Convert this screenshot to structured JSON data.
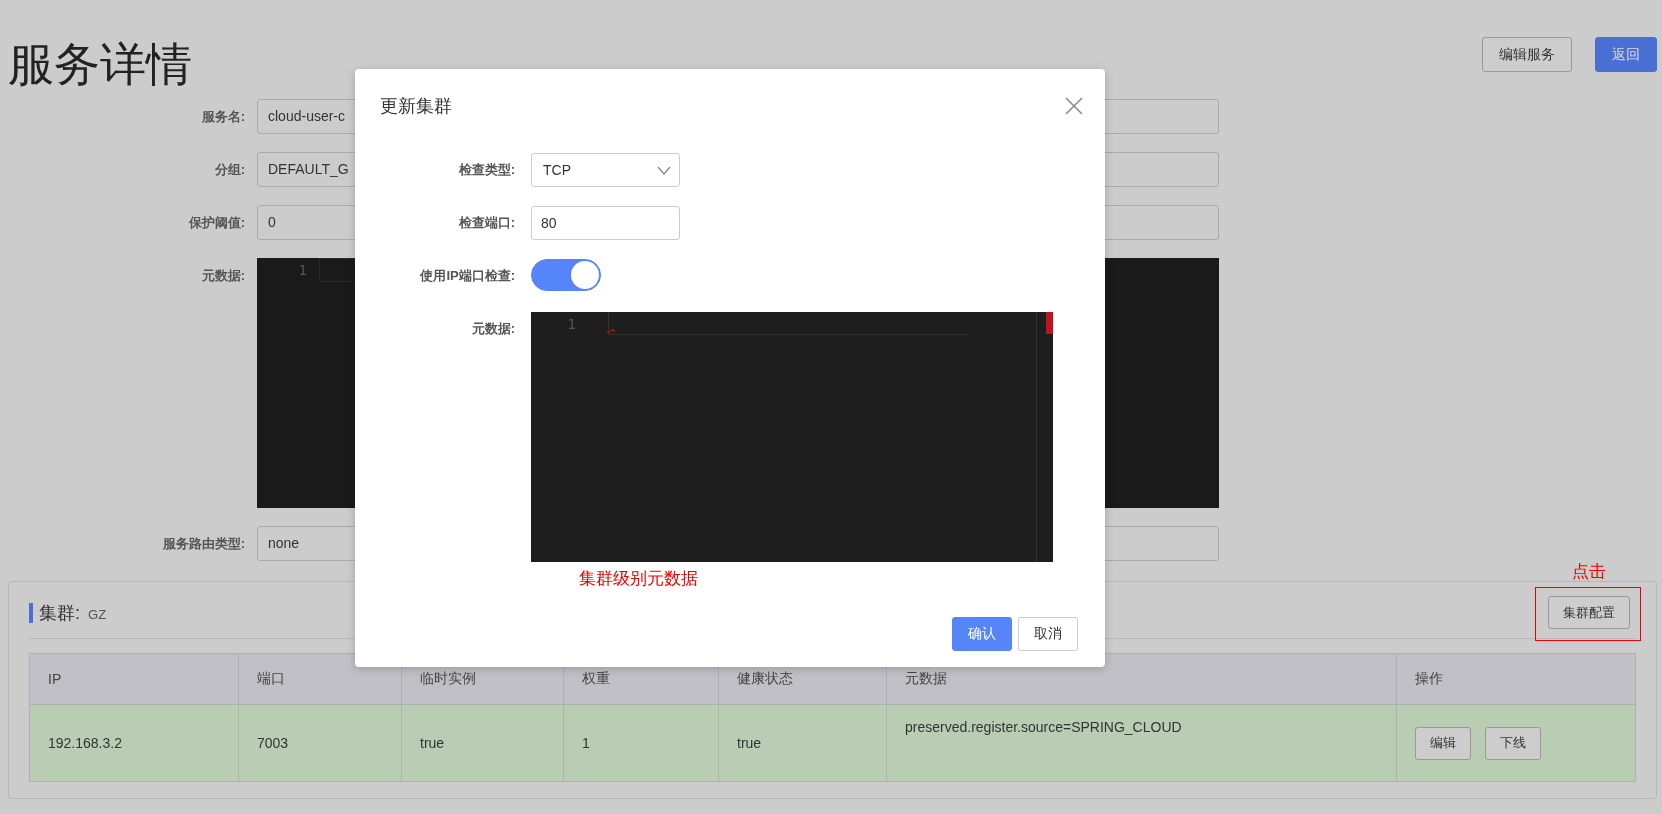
{
  "page": {
    "title": "服务详情",
    "buttons": [
      {
        "label": "编辑服务",
        "kind": "default"
      },
      {
        "label": "返回",
        "kind": "primary"
      }
    ]
  },
  "form": {
    "fields": [
      {
        "label": "服务名:",
        "kind": "input",
        "value": "cloud-user-c"
      },
      {
        "label": "分组:",
        "kind": "input",
        "value": "DEFAULT_G"
      },
      {
        "label": "保护阈值:",
        "kind": "input",
        "value": "0"
      },
      {
        "label": "元数据:",
        "kind": "editor",
        "line_numbers": [
          "1"
        ]
      },
      {
        "label": "服务路由类型:",
        "kind": "input",
        "value": "none"
      }
    ]
  },
  "cluster": {
    "title": "集群:",
    "name": "GZ",
    "config_button": "集群配置",
    "annotation": "点击",
    "table": {
      "columns": [
        "IP",
        "端口",
        "临时实例",
        "权重",
        "健康状态",
        "元数据",
        "操作"
      ],
      "rows": [
        {
          "highlighted": true,
          "cells": [
            "192.168.3.2",
            "7003",
            "true",
            "1",
            "true",
            "preserved.register.source=SPRING_CLOUD"
          ],
          "actions": [
            "编辑",
            "下线"
          ]
        }
      ]
    }
  },
  "dialog": {
    "title": "更新集群",
    "fields": [
      {
        "label": "检查类型:",
        "kind": "select",
        "value": "TCP"
      },
      {
        "label": "检查端口:",
        "kind": "input",
        "value": "80"
      },
      {
        "label": "使用IP端口检查:",
        "kind": "switch",
        "on": true
      },
      {
        "label": "元数据:",
        "kind": "editor",
        "line_numbers": [
          "1"
        ]
      }
    ],
    "annotation": "集群级别元数据",
    "buttons": [
      {
        "label": "确认",
        "kind": "primary"
      },
      {
        "label": "取消",
        "kind": "default"
      }
    ]
  }
}
